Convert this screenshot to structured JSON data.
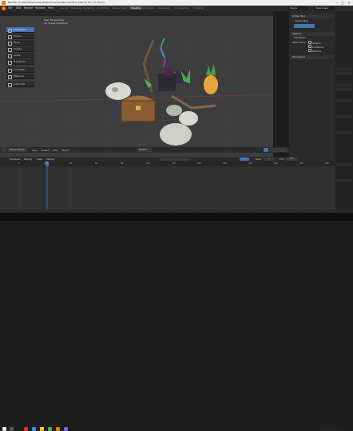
{
  "window": {
    "title": "Blender [C:\\Users\\Owner\\Desktop\\Immersive\\Blender\\Hot_STAL_B_01_7.3.blend]"
  },
  "menu": {
    "items": [
      "File",
      "Edit",
      "Render",
      "Window",
      "Help"
    ],
    "workspaces": [
      "Layout",
      "Modeling",
      "Sculpting",
      "UV Editing",
      "Texture Paint",
      "Shading",
      "Animation",
      "Rendering",
      "Compositing",
      "Scripting"
    ],
    "active_workspace": "Layout",
    "scene": "Scene",
    "view_layer": "View Layer"
  },
  "viewport": {
    "view_name": "User Perspective",
    "collection": "(1) Scene Collection",
    "tools": [
      "Select Box",
      "Cursor",
      "Move",
      "Rotate",
      "Scale",
      "Transform",
      "Annotate",
      "Measure",
      "Add Cube"
    ],
    "active_tool_index": 0,
    "footer": {
      "mode": "Object Mode",
      "menus": [
        "View",
        "Select",
        "Add",
        "Object"
      ],
      "orientation": "Global"
    }
  },
  "properties": {
    "tool_header": "Active Tool",
    "tool_name": "Select Box",
    "options": "Options",
    "transform": "Transform",
    "affect_only": "Affect Only",
    "checks": [
      "Origins",
      "Locations",
      "Parents"
    ],
    "workspace": "Workspace"
  },
  "timeline": {
    "menus": [
      "Playback",
      "Keying",
      "View",
      "Marker"
    ],
    "frame_labels": [
      "0",
      "20",
      "40",
      "60",
      "80",
      "100",
      "120",
      "140",
      "160",
      "180",
      "200",
      "220",
      "240"
    ],
    "current_frame": "1",
    "start_label": "Start",
    "start": "1",
    "end_label": "End",
    "end": "250"
  },
  "colors": {
    "accent": "#4772b3",
    "blender_orange": "#e87d0d",
    "viewport_bg": "#3d3d3d"
  }
}
